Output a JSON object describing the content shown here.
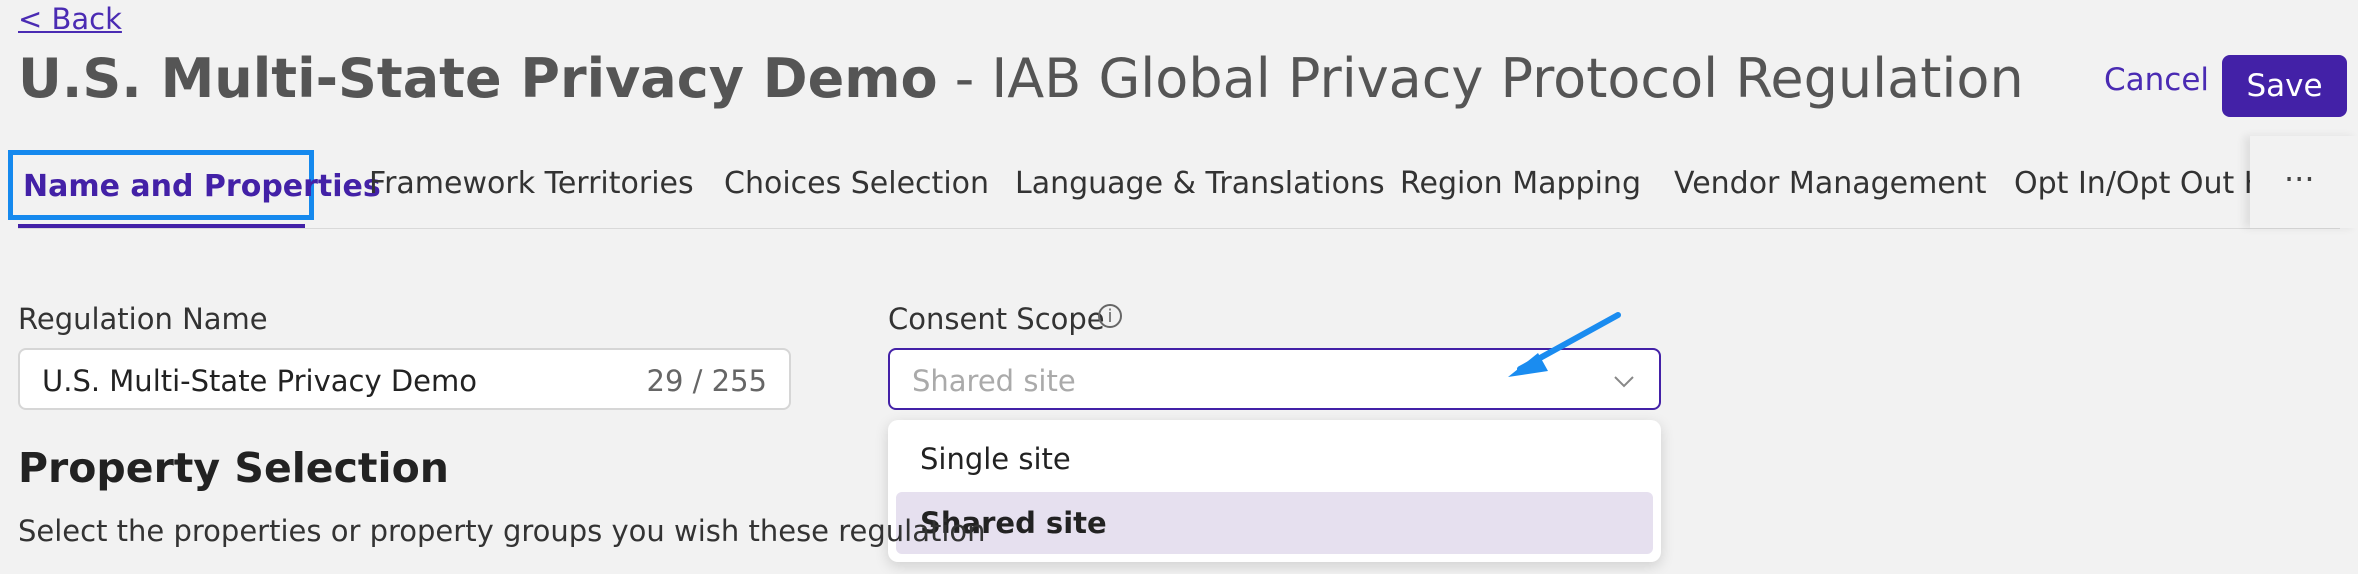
{
  "nav": {
    "back_label": "< Back"
  },
  "header": {
    "title_bold": "U.S. Multi-State Privacy Demo",
    "title_rest": " - IAB Global Privacy Protocol Regulation",
    "cancel_label": "Cancel",
    "save_label": "Save"
  },
  "tabs": [
    {
      "label": "Name and Properties",
      "active": true
    },
    {
      "label": "Framework Territories"
    },
    {
      "label": "Choices Selection"
    },
    {
      "label": "Language & Translations"
    },
    {
      "label": "Region Mapping"
    },
    {
      "label": "Vendor Management"
    },
    {
      "label": "Opt In/Opt Out Ho"
    }
  ],
  "more_label": "···",
  "form": {
    "regulation_name": {
      "label": "Regulation Name",
      "value": "U.S. Multi-State Privacy Demo",
      "count": "29 / 255"
    },
    "consent_scope": {
      "label": "Consent Scope",
      "info_glyph": "i",
      "placeholder": "Shared site",
      "options": [
        "Single site",
        "Shared site"
      ],
      "highlighted": "Shared site"
    }
  },
  "property_selection": {
    "heading": "Property Selection",
    "description": "Select the properties or property groups you wish these regulation"
  },
  "colors": {
    "accent": "#4321a7",
    "highlight_box": "#1589ee",
    "annotation_arrow": "#1a8cf0"
  }
}
